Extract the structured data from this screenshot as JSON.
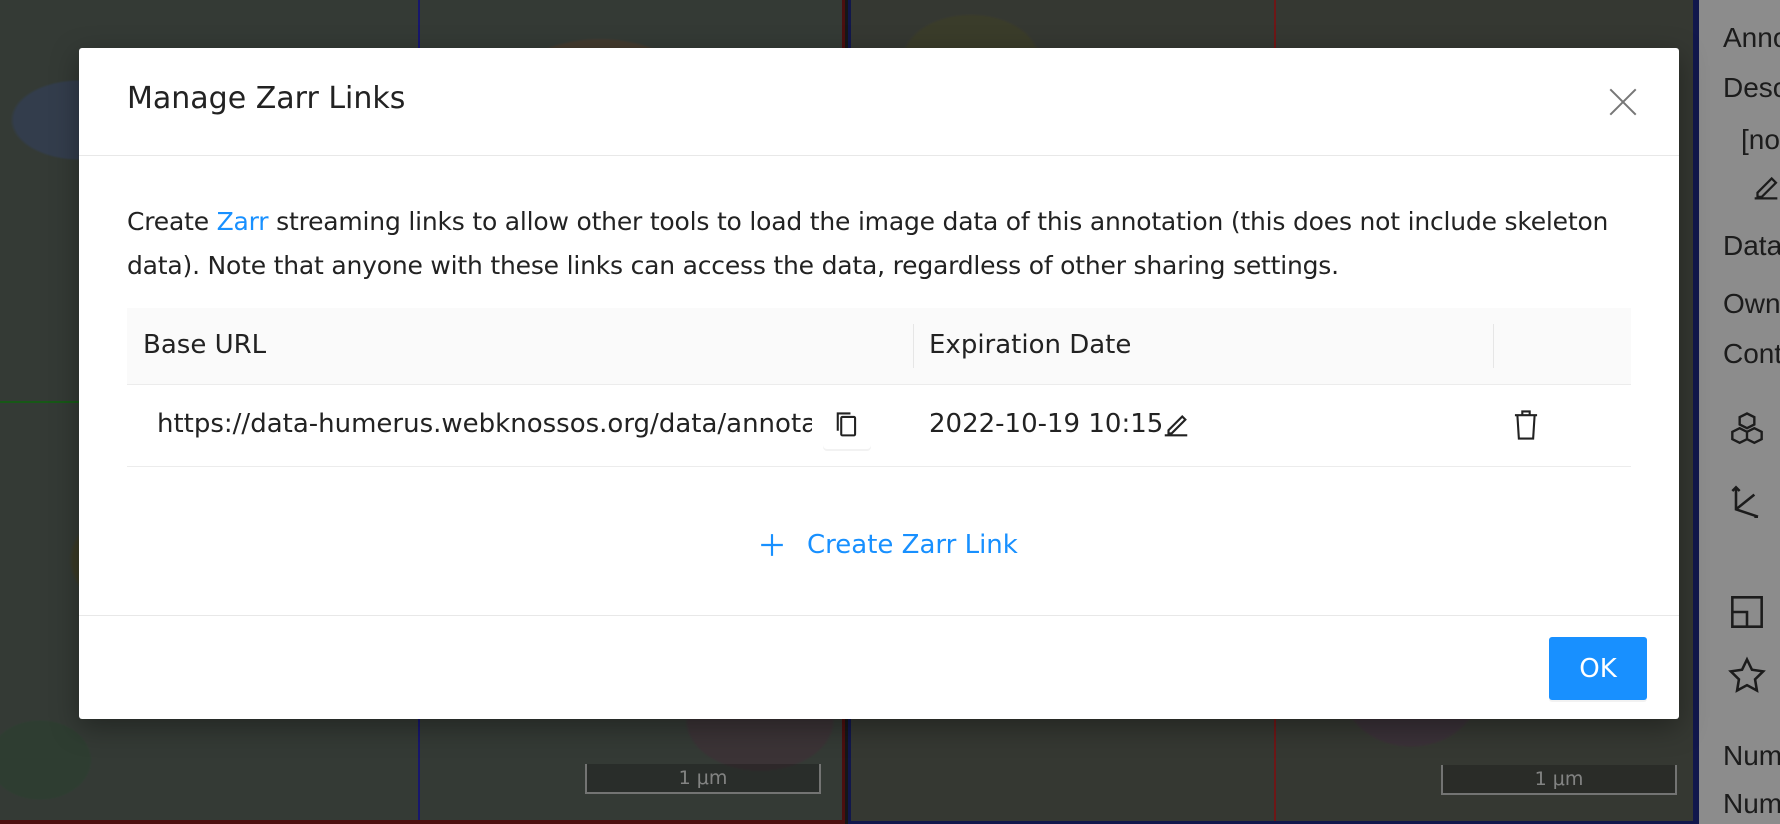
{
  "viewports": {
    "left_scale_label": "1 μm",
    "right_scale_label": "1 μm"
  },
  "sidebar": {
    "labels": [
      "Anno",
      "Desc",
      "[no",
      "Data",
      "Own",
      "Cont",
      "Num",
      "Num"
    ],
    "icons": [
      "edit-icon",
      "cubes-icon",
      "axes-icon",
      "layout-icon",
      "star-icon"
    ]
  },
  "modal": {
    "title": "Manage Zarr Links",
    "description_prefix": "Create ",
    "description_link": "Zarr",
    "description_suffix": " streaming links to allow other tools to load the image data of this annotation (this does not include skeleton data). Note that anyone with these links can access the data, regardless of other sharing settings.",
    "table": {
      "columns": [
        "Base URL",
        "Expiration Date",
        ""
      ],
      "rows": [
        {
          "base_url": "https://data-humerus.webknossos.org/data/annotations/zarr/",
          "expiration_date": "2022-10-19 10:15"
        }
      ]
    },
    "create_link_label": "Create Zarr Link",
    "ok_label": "OK"
  },
  "colors": {
    "accent": "#1890ff",
    "left_viewport_border": "#8a1d1d",
    "right_viewport_border": "#1f2a8a"
  }
}
